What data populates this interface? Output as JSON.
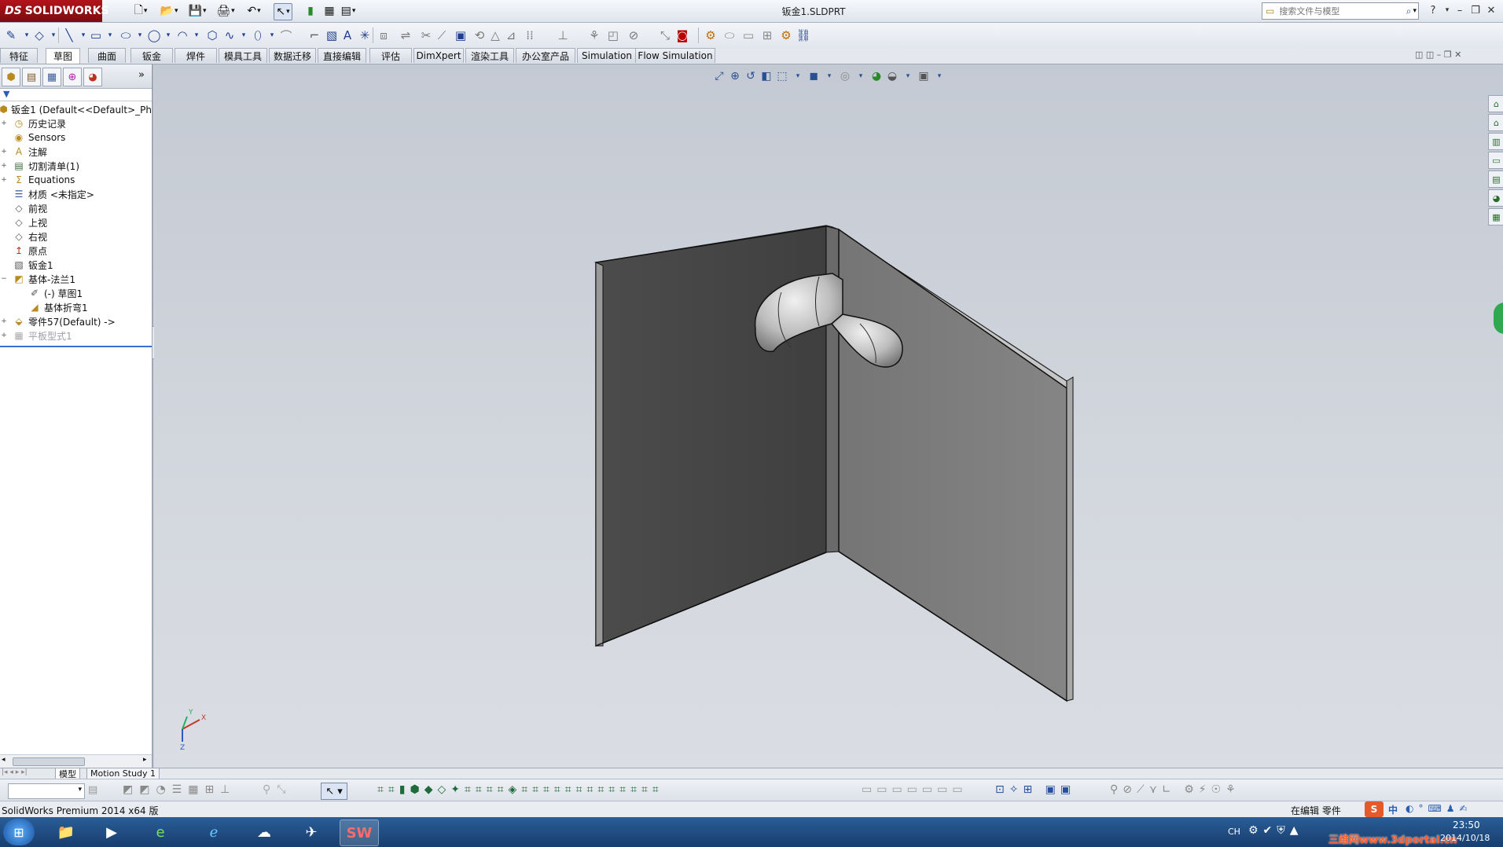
{
  "app": {
    "logo_text": "SOLIDWORKS",
    "logo_mark": "DS",
    "document_title": "钣金1.SLDPRT",
    "search_placeholder": "搜索文件与模型"
  },
  "command_tabs": [
    "特征",
    "草图",
    "曲面",
    "钣金",
    "焊件",
    "模具工具",
    "数据迁移",
    "直接编辑",
    "评估",
    "DimXpert",
    "渲染工具",
    "办公室产品",
    "Simulation",
    "Flow Simulation"
  ],
  "active_tab": "草图",
  "tree": {
    "items": [
      {
        "label": "钣金1  (Default<<Default>_Ph",
        "icon": "part-icon",
        "expander": ""
      },
      {
        "label": "历史记录",
        "icon": "history-icon",
        "expander": "+"
      },
      {
        "label": "Sensors",
        "icon": "sensors-icon",
        "expander": ""
      },
      {
        "label": "注解",
        "icon": "annotations-icon",
        "expander": "+"
      },
      {
        "label": "切割清单(1)",
        "icon": "cut-list-icon",
        "expander": "+"
      },
      {
        "label": "Equations",
        "icon": "equations-icon",
        "expander": "+"
      },
      {
        "label": "材质 <未指定>",
        "icon": "material-icon",
        "expander": ""
      },
      {
        "label": "前视",
        "icon": "plane-icon",
        "expander": ""
      },
      {
        "label": "上视",
        "icon": "plane-icon",
        "expander": ""
      },
      {
        "label": "右视",
        "icon": "plane-icon",
        "expander": ""
      },
      {
        "label": "原点",
        "icon": "origin-icon",
        "expander": ""
      },
      {
        "label": "钣金1",
        "icon": "sheet-metal-icon",
        "expander": ""
      },
      {
        "label": "基体-法兰1",
        "icon": "base-flange-icon",
        "expander": "−"
      },
      {
        "label": "(-) 草图1",
        "icon": "sketch-icon",
        "expander": ""
      },
      {
        "label": "基体折弯1",
        "icon": "bend-icon",
        "expander": ""
      },
      {
        "label": "零件57(Default) ->",
        "icon": "library-feature-icon",
        "expander": "+"
      },
      {
        "label": "平板型式1",
        "icon": "flat-pattern-icon",
        "expander": "+"
      }
    ]
  },
  "bottom_tabs": [
    "模型",
    "Motion Study 1"
  ],
  "status": {
    "left": "SolidWorks Premium 2014 x64 版",
    "right": "在编辑 零件"
  },
  "taskbar": {
    "time": "23:50",
    "date": "2014/10/18",
    "lang": "CH",
    "watermark": "三维网www.3dportal.cn",
    "ime": "中"
  },
  "triad": {
    "x": "X",
    "y": "Y",
    "z": "Z"
  },
  "colors": {
    "brand": "#b2131a",
    "viewport_bg": "#cfd3da",
    "taskbar": "#1f4b80",
    "left_panel_face": "#4a4a4a",
    "right_panel_face": "#7e7e7e"
  }
}
